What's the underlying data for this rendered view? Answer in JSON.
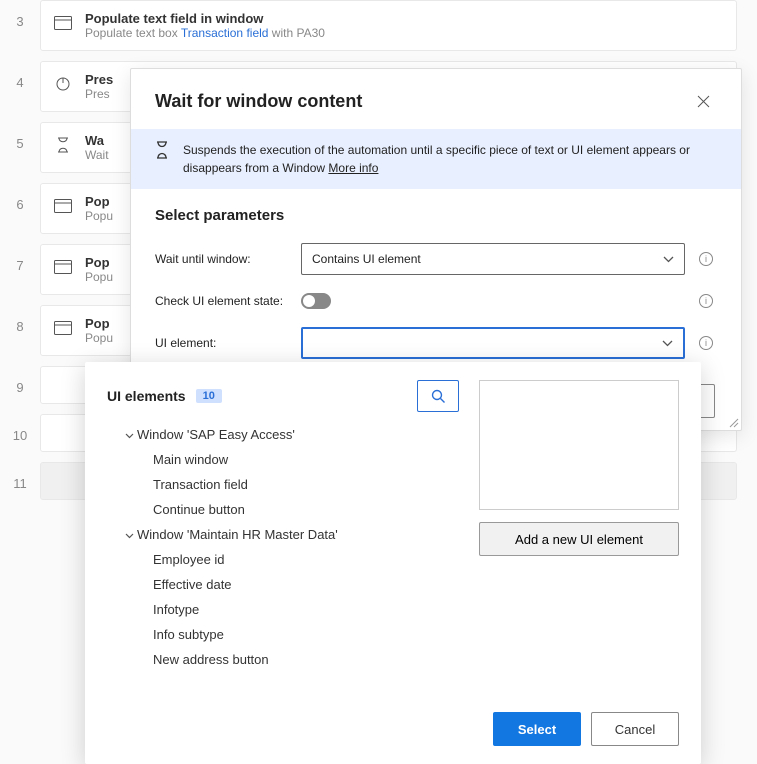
{
  "steps": [
    {
      "num": "3",
      "title": "Populate text field in window",
      "sub_pre": "Populate text box ",
      "sub_link": "Transaction field",
      "sub_post": " with PA30",
      "icon": "window"
    },
    {
      "num": "4",
      "title": "Pres",
      "sub_pre": "Pres",
      "icon": "mouse"
    },
    {
      "num": "5",
      "title": "Wa",
      "sub_pre": "Wait",
      "icon": "hourglass"
    },
    {
      "num": "6",
      "title": "Pop",
      "sub_pre": "Popu",
      "icon": "window"
    },
    {
      "num": "7",
      "title": "Pop",
      "sub_pre": "Popu",
      "icon": "window"
    },
    {
      "num": "8",
      "title": "Pop",
      "sub_pre": "Popu",
      "icon": "window"
    },
    {
      "num": "9",
      "title": "",
      "sub_pre": "",
      "icon": ""
    },
    {
      "num": "10",
      "title": "",
      "sub_pre": "",
      "icon": ""
    },
    {
      "num": "11",
      "title": "",
      "sub_pre": "",
      "icon": "",
      "selected": true
    }
  ],
  "modal": {
    "title": "Wait for window content",
    "info": "Suspends the execution of the automation until a specific piece of text or UI element appears or disappears from a Window ",
    "more": "More info",
    "section": "Select parameters",
    "labels": {
      "wait_until": "Wait until window:",
      "check_state": "Check UI element state:",
      "ui_element": "UI element:"
    },
    "wait_until_value": "Contains UI element",
    "ui_element_value": ""
  },
  "popup": {
    "title": "UI elements",
    "count": "10",
    "tree": [
      {
        "type": "group",
        "label": "Window 'SAP Easy Access'"
      },
      {
        "type": "leaf",
        "label": "Main window"
      },
      {
        "type": "leaf",
        "label": "Transaction field"
      },
      {
        "type": "leaf",
        "label": "Continue button"
      },
      {
        "type": "group",
        "label": "Window 'Maintain HR Master Data'"
      },
      {
        "type": "leaf",
        "label": "Employee id"
      },
      {
        "type": "leaf",
        "label": "Effective date"
      },
      {
        "type": "leaf",
        "label": "Infotype"
      },
      {
        "type": "leaf",
        "label": "Info subtype"
      },
      {
        "type": "leaf",
        "label": "New address button"
      }
    ],
    "add_label": "Add a new UI element",
    "select_label": "Select",
    "cancel_label": "Cancel"
  }
}
